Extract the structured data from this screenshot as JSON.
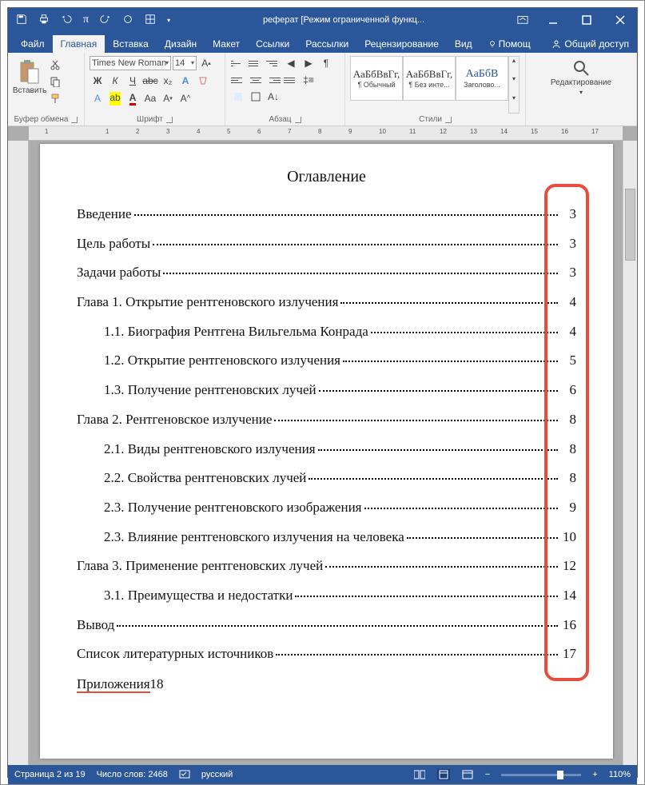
{
  "titlebar": {
    "title": "реферат [Режим ограниченной функц..."
  },
  "tabs": {
    "file": "Файл",
    "home": "Главная",
    "insert": "Вставка",
    "design": "Дизайн",
    "layout": "Макет",
    "references": "Ссылки",
    "mailings": "Рассылки",
    "review": "Рецензирование",
    "view": "Вид",
    "tell": "Помощ",
    "share": "Общий доступ"
  },
  "ribbon": {
    "paste": "Вставить",
    "clipboard": "Буфер обмена",
    "font_name": "Times New Roman",
    "font_size": "14",
    "font_group": "Шрифт",
    "paragraph_group": "Абзац",
    "styles_group": "Стили",
    "editing_group": "Редактирование",
    "editing_btn": "Редактирование",
    "style_preview": "АаБбВвГг,",
    "style_preview_h": "АаБбВ",
    "style1": "¶ Обычный",
    "style2": "¶ Без инте...",
    "style3": "Заголово..."
  },
  "document": {
    "title": "Оглавление",
    "toc": [
      {
        "text": "Введение",
        "page": "3",
        "sub": false
      },
      {
        "text": "Цель работы",
        "page": "3",
        "sub": false
      },
      {
        "text": "Задачи работы",
        "page": "3",
        "sub": false
      },
      {
        "text": "Глава 1. Открытие рентгеновского излучения",
        "page": "4",
        "sub": false
      },
      {
        "text": "1.1. Биография Рентгена Вильгельма Конрада",
        "page": "4",
        "sub": true
      },
      {
        "text": "1.2. Открытие рентгеновского излучения",
        "page": "5",
        "sub": true
      },
      {
        "text": "1.3. Получение рентгеновских лучей",
        "page": "6",
        "sub": true
      },
      {
        "text": "Глава 2. Рентгеновское излучение",
        "page": "8",
        "sub": false
      },
      {
        "text": "2.1. Виды рентгеновского излучения",
        "page": "8",
        "sub": true
      },
      {
        "text": "2.2. Свойства рентгеновских лучей",
        "page": "8",
        "sub": true
      },
      {
        "text": "2.3. Получение рентгеновского изображения",
        "page": "9",
        "sub": true
      },
      {
        "text": "2.3. Влияние рентгеновского излучения на человека",
        "page": "10",
        "sub": true
      },
      {
        "text": "Глава 3. Применение рентгеновских лучей",
        "page": "12",
        "sub": false
      },
      {
        "text": "3.1. Преимущества и недостатки",
        "page": "14",
        "sub": true
      },
      {
        "text": "Вывод",
        "page": "16",
        "sub": false
      },
      {
        "text": "Список литературных источников",
        "page": "17",
        "sub": false
      }
    ],
    "last_text": "Приложения",
    "last_page": "18"
  },
  "status": {
    "page": "Страница 2 из 19",
    "words": "Число слов: 2468",
    "lang": "русский",
    "zoom": "110%"
  },
  "ruler": {
    "marks": [
      "1",
      "",
      "1",
      "2",
      "3",
      "4",
      "5",
      "6",
      "7",
      "8",
      "9",
      "10",
      "11",
      "12",
      "13",
      "14",
      "15",
      "16",
      "17"
    ]
  }
}
